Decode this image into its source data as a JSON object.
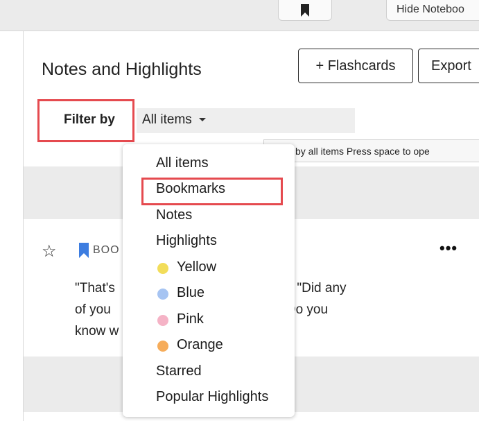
{
  "topbar": {
    "hide_notebook_label": "Hide Noteboo"
  },
  "panel": {
    "title": "Notes and Highlights",
    "flashcards_label": "+ Flashcards",
    "export_label": "Export"
  },
  "filter": {
    "label": "Filter by",
    "selected": "All items",
    "tooltip": "Filter by all items Press space to ope"
  },
  "annotation": {
    "type_label": "BOO",
    "text_line1": "\"That's",
    "text_line1_end": "out,\" Jo said. \"Did any",
    "text_line2": "of you",
    "text_line2_end": "st night? Do you",
    "text_line3": "know w",
    "more_glyph": "•••"
  },
  "menu": {
    "items": [
      {
        "label": "All items"
      },
      {
        "label": "Bookmarks"
      },
      {
        "label": "Notes"
      },
      {
        "label": "Highlights"
      },
      {
        "label": "Yellow",
        "color": "#f2dd5a"
      },
      {
        "label": "Blue",
        "color": "#a6c4f2"
      },
      {
        "label": "Pink",
        "color": "#f5b3c6"
      },
      {
        "label": "Orange",
        "color": "#f6ac5a"
      },
      {
        "label": "Starred"
      },
      {
        "label": "Popular Highlights"
      }
    ]
  },
  "colors": {
    "highlight_box": "#e54a4f",
    "bookmark_blue": "#3d7de0"
  }
}
